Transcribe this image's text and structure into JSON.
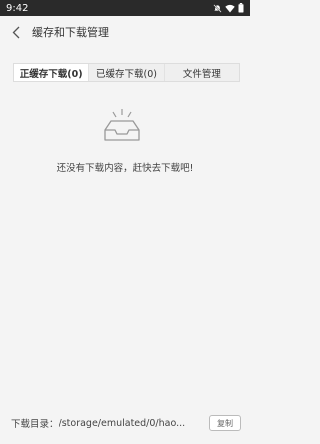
{
  "status_bar": {
    "time": "9:42",
    "icons": [
      "notification-off-icon",
      "wifi-icon",
      "battery-icon"
    ]
  },
  "header": {
    "title": "缓存和下载管理",
    "back_icon": "back-arrow-icon"
  },
  "tabs": [
    {
      "label": "正缓存下载(0)",
      "active": true
    },
    {
      "label": "已缓存下载(0)",
      "active": false
    },
    {
      "label": "文件管理",
      "active": false
    }
  ],
  "empty_state": {
    "icon": "empty-tray-icon",
    "message": "还没有下载内容，赶快去下载吧!"
  },
  "footer": {
    "label": "下载目录：",
    "path": "/storage/emulated/0/hao...",
    "copy_label": "复制"
  }
}
